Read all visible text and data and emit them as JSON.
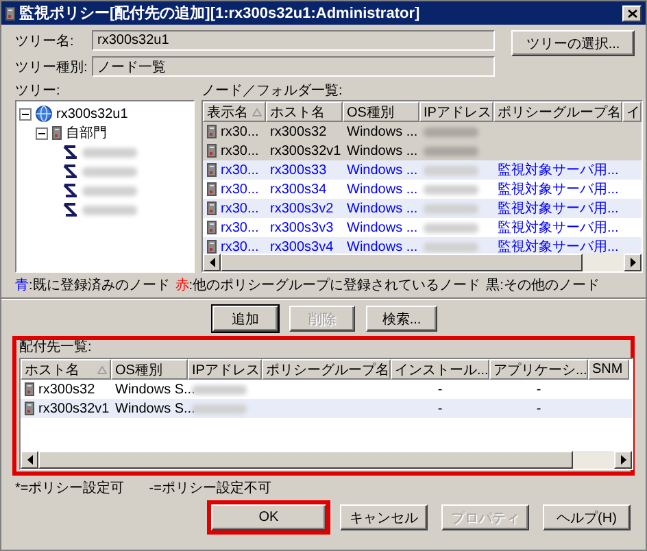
{
  "window": {
    "title": "監視ポリシー[配付先の追加][1:rx300s32u1:Administrator]"
  },
  "fields": [
    {
      "label": "ツリー名:",
      "value": "rx300s32u1"
    },
    {
      "label": "ツリー種別:",
      "value": "ノード一覧"
    }
  ],
  "tree_select_button": "ツリーの選択...",
  "tree": {
    "label": "ツリー:",
    "items": [
      {
        "label": "rx300s32u1",
        "kind": "root",
        "expanded": true,
        "children": [
          {
            "label": "自部門",
            "kind": "folder",
            "expanded": true,
            "children": [
              {
                "kind": "node"
              },
              {
                "kind": "node"
              },
              {
                "kind": "node"
              },
              {
                "kind": "node"
              }
            ]
          }
        ]
      }
    ]
  },
  "node_list": {
    "label": "ノード／フォルダ一覧:",
    "columns": [
      {
        "label": "表示名",
        "sorted": true
      },
      {
        "label": "ホスト名",
        "sorted": false
      },
      {
        "label": "OS種別",
        "sorted": false
      },
      {
        "label": "IPアドレス",
        "sorted": false
      },
      {
        "label": "ポリシーグループ名",
        "sorted": false
      },
      {
        "label": "イ",
        "sorted": false
      }
    ],
    "rows": [
      {
        "display_name": "rx30...",
        "host": "rx300s32",
        "os": "Windows ...",
        "policy": "",
        "color": "#000000"
      },
      {
        "display_name": "rx30...",
        "host": "rx300s32v1",
        "os": "Windows ...",
        "policy": "",
        "color": "#000000"
      },
      {
        "display_name": "rx30...",
        "host": "rx300s33",
        "os": "Windows ...",
        "policy": "監視対象サーバ用...",
        "color": "#0000ff"
      },
      {
        "display_name": "rx30...",
        "host": "rx300s34",
        "os": "Windows ...",
        "policy": "監視対象サーバ用...",
        "color": "#0000ff"
      },
      {
        "display_name": "rx30...",
        "host": "rx300s3v2",
        "os": "Windows ...",
        "policy": "監視対象サーバ用...",
        "color": "#0000ff"
      },
      {
        "display_name": "rx30...",
        "host": "rx300s3v3",
        "os": "Windows ...",
        "policy": "監視対象サーバ用...",
        "color": "#0000ff"
      },
      {
        "display_name": "rx30...",
        "host": "rx300s3v4",
        "os": "Windows ...",
        "policy": "監視対象サーバ用...",
        "color": "#0000ff"
      }
    ]
  },
  "legend": [
    {
      "mark": "青",
      "text": ":既に登録済みのノード",
      "color": "#0000ff"
    },
    {
      "mark": "赤",
      "text": ":他のポリシーグループに登録されているノード",
      "color": "#ff0000"
    },
    {
      "mark": "黒",
      "text": ":その他のノード",
      "color": "#000000"
    }
  ],
  "actions": [
    {
      "label": "追加",
      "default": true,
      "disabled": false
    },
    {
      "label": "削除",
      "default": false,
      "disabled": true
    },
    {
      "label": "検索...",
      "default": false,
      "disabled": false
    }
  ],
  "destinations": {
    "label": "配付先一覧:",
    "highlighted": true,
    "columns": [
      {
        "label": "ホスト名",
        "sorted": true
      },
      {
        "label": "OS種別",
        "sorted": false
      },
      {
        "label": "IPアドレス",
        "sorted": false
      },
      {
        "label": "ポリシーグループ名",
        "sorted": false
      },
      {
        "label": "インストール...",
        "sorted": false
      },
      {
        "label": "アプリケーシ...",
        "sorted": false
      },
      {
        "label": "SNM",
        "sorted": false
      }
    ],
    "rows": [
      {
        "host": "rx300s32",
        "os": "Windows S...",
        "policy": "",
        "install": "-",
        "application": "-"
      },
      {
        "host": "rx300s32v1",
        "os": "Windows S...",
        "policy": "",
        "install": "-",
        "application": "-"
      }
    ]
  },
  "notes": [
    "*=ポリシー設定可",
    "-=ポリシー設定不可"
  ],
  "buttons": [
    {
      "label": "OK",
      "disabled": false,
      "highlighted": true
    },
    {
      "label": "キャンセル",
      "disabled": false,
      "highlighted": false
    },
    {
      "label": "プロパティ",
      "disabled": true,
      "highlighted": false
    },
    {
      "label": "ヘルプ(H)",
      "disabled": false,
      "highlighted": false
    }
  ]
}
